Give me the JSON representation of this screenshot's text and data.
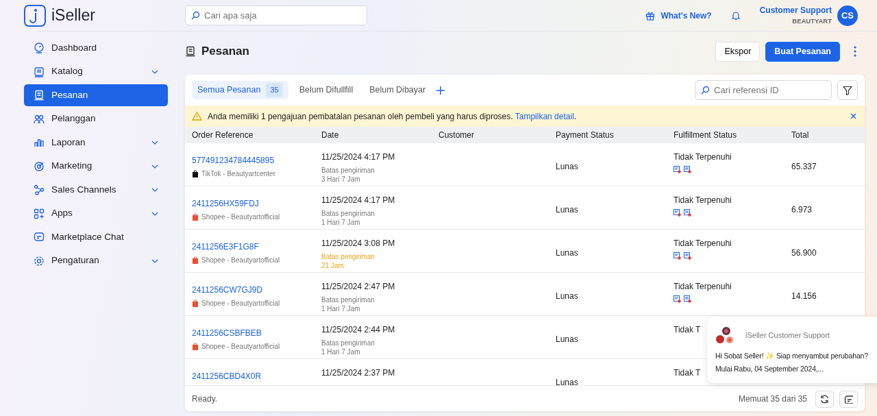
{
  "brand": {
    "name": "iSeller"
  },
  "search": {
    "placeholder": "Cari apa saja"
  },
  "header": {
    "whats_new": "What's New?",
    "user_name": "Customer Support",
    "store": "BEAUTYART",
    "avatar": "CS"
  },
  "sidebar": {
    "items": [
      {
        "label": "Dashboard",
        "expandable": false,
        "selected": false
      },
      {
        "label": "Katalog",
        "expandable": true,
        "selected": false
      },
      {
        "label": "Pesanan",
        "expandable": false,
        "selected": true
      },
      {
        "label": "Pelanggan",
        "expandable": false,
        "selected": false
      },
      {
        "label": "Laporan",
        "expandable": true,
        "selected": false
      },
      {
        "label": "Marketing",
        "expandable": true,
        "selected": false
      },
      {
        "label": "Sales Channels",
        "expandable": true,
        "selected": false
      },
      {
        "label": "Apps",
        "expandable": true,
        "selected": false
      },
      {
        "label": "Marketplace Chat",
        "expandable": false,
        "selected": false
      },
      {
        "label": "Pengaturan",
        "expandable": true,
        "selected": false
      }
    ]
  },
  "page": {
    "title": "Pesanan",
    "buttons": [
      {
        "label": "Ekspor",
        "kind": "secondary"
      },
      {
        "label": "Buat Pesanan",
        "kind": "primary"
      }
    ]
  },
  "tabs": [
    {
      "label": "Semua Pesanan",
      "count": "35",
      "selected": true
    },
    {
      "label": "Belum Difullfill",
      "selected": false
    },
    {
      "label": "Belum Dibayar",
      "selected": false
    }
  ],
  "ref_search": {
    "placeholder": "Cari referensi ID"
  },
  "alert": {
    "text": "Anda memiliki 1 pengajuan pembatalan pesanan oleh pembeli yang harus diproses.",
    "link": "Tampilkan detail",
    "trail": "."
  },
  "table": {
    "columns": [
      "Order Reference",
      "Date",
      "Customer",
      "Payment Status",
      "Fulfillment Status",
      "Total"
    ],
    "rows": [
      {
        "ref": "577491234784445895",
        "kind": "tiktok",
        "source": "TikTok - Beautyartcenter",
        "date": "11/25/2024 4:17 PM",
        "deadline_label": "Batas pengiriman",
        "deadline": "3 Hari 7 Jam",
        "urgent": false,
        "payment": "Lunas",
        "fulfillment": "Tidak Terpenuhi",
        "total": "65.337"
      },
      {
        "ref": "2411256HX59FDJ",
        "kind": "shopee",
        "source": "Shopee - Beautyartofficial",
        "date": "11/25/2024 4:17 PM",
        "deadline_label": "Batas pengiriman",
        "deadline": "1 Hari 7 Jam",
        "urgent": false,
        "payment": "Lunas",
        "fulfillment": "Tidak Terpenuhi",
        "total": "6.973"
      },
      {
        "ref": "2411256E3F1G8F",
        "kind": "shopee",
        "source": "Shopee - Beautyartofficial",
        "date": "11/25/2024 3:08 PM",
        "deadline_label": "Batas pengiriman",
        "deadline": "21 Jam",
        "urgent": true,
        "payment": "Lunas",
        "fulfillment": "Tidak Terpenuhi",
        "total": "56.900"
      },
      {
        "ref": "2411256CW7GJ9D",
        "kind": "shopee",
        "source": "Shopee - Beautyartofficial",
        "date": "11/25/2024 2:47 PM",
        "deadline_label": "Batas pengiriman",
        "deadline": "1 Hari 7 Jam",
        "urgent": false,
        "payment": "Lunas",
        "fulfillment": "Tidak Terpenuhi",
        "total": "14.156"
      },
      {
        "ref": "2411256CSBFBEB",
        "kind": "shopee",
        "source": "Shopee - Beautyartofficial",
        "date": "11/25/2024 2:44 PM",
        "deadline_label": "Batas pengiriman",
        "deadline": "1 Hari 7 Jam",
        "urgent": false,
        "payment": "Lunas",
        "fulfillment": "Tidak T"
      },
      {
        "ref": "2411256CBD4X0R",
        "date": "11/25/2024 2:37 PM",
        "payment": "Lunas",
        "fulfillment": "Tidak T"
      }
    ]
  },
  "footer": {
    "status": "Ready.",
    "count": "Memuat 35 dari 35"
  },
  "chat_popup": {
    "sender": "iSeller Customer Support",
    "message_start": "Hi Sobat Seller!",
    "sparkle": "✨",
    "message_rest": "Siap menyambut perubahan? Mulai Rabu, 04 September 2024,..."
  }
}
